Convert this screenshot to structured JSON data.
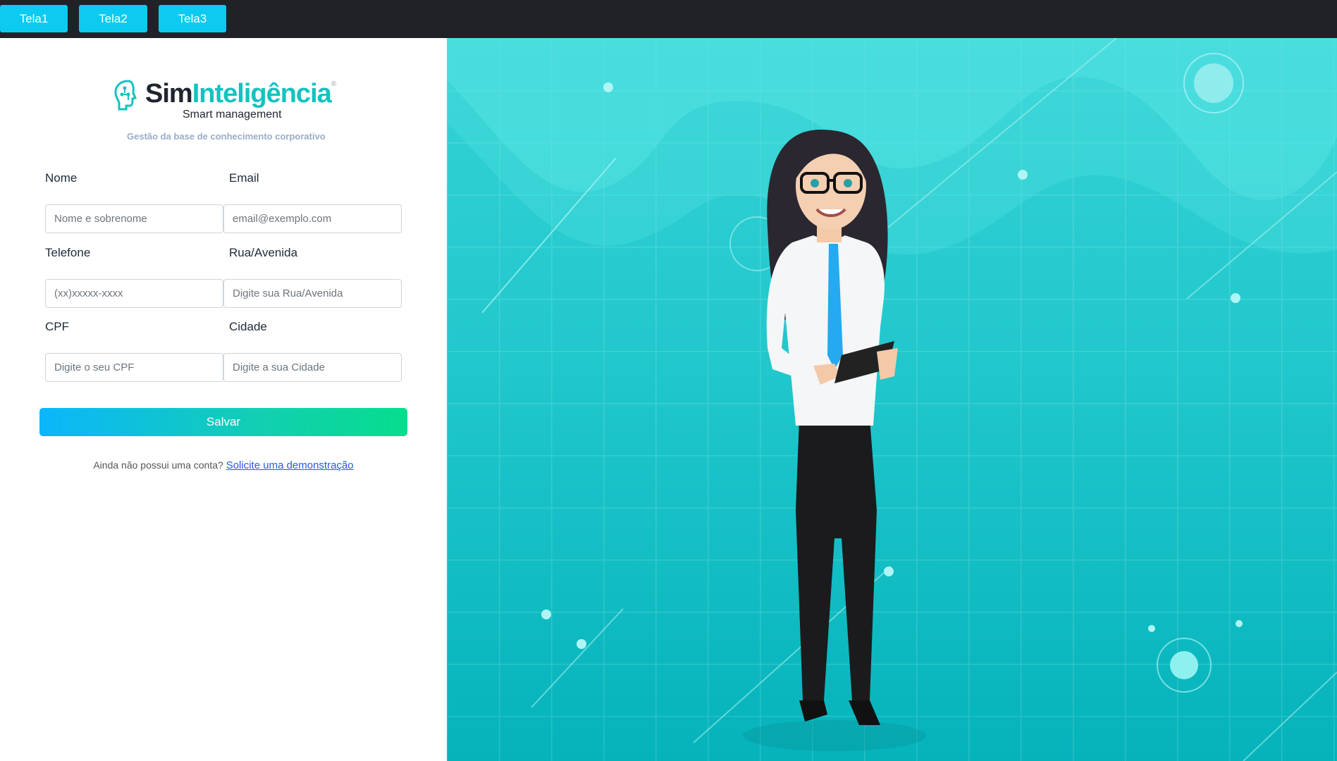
{
  "nav": {
    "tabs": [
      {
        "label": "Tela1"
      },
      {
        "label": "Tela2"
      },
      {
        "label": "Tela3"
      }
    ]
  },
  "brand": {
    "name_part1": "Sim",
    "name_part2": "Inteligência",
    "registered": "®",
    "subtitle": "Smart management",
    "tagline": "Gestão da base de conhecimento corporativo",
    "color_dark": "#1f2530",
    "color_accent": "#12c3c0"
  },
  "form": {
    "nome": {
      "label": "Nome",
      "placeholder": "Nome e sobrenome"
    },
    "email": {
      "label": "Email",
      "placeholder": "email@exemplo.com"
    },
    "telefone": {
      "label": "Telefone",
      "placeholder": "(xx)xxxxx-xxxx"
    },
    "rua": {
      "label": "Rua/Avenida",
      "placeholder": "Digite sua Rua/Avenida"
    },
    "cpf": {
      "label": "CPF",
      "placeholder": "Digite o seu CPF"
    },
    "cidade": {
      "label": "Cidade",
      "placeholder": "Digite a sua Cidade"
    },
    "save_label": "Salvar"
  },
  "signup": {
    "prompt": "Ainda não possui uma conta?",
    "link_label": "Solicite uma demonstração"
  },
  "hero": {
    "illustration": "businesswoman-holding-tablet",
    "bg_color": "#1cc4c9",
    "logo_icon": "brain-circuit-icon"
  },
  "colors": {
    "topbar": "#202227",
    "tab_button": "#0dcaf0",
    "link": "#1e5ee0"
  }
}
